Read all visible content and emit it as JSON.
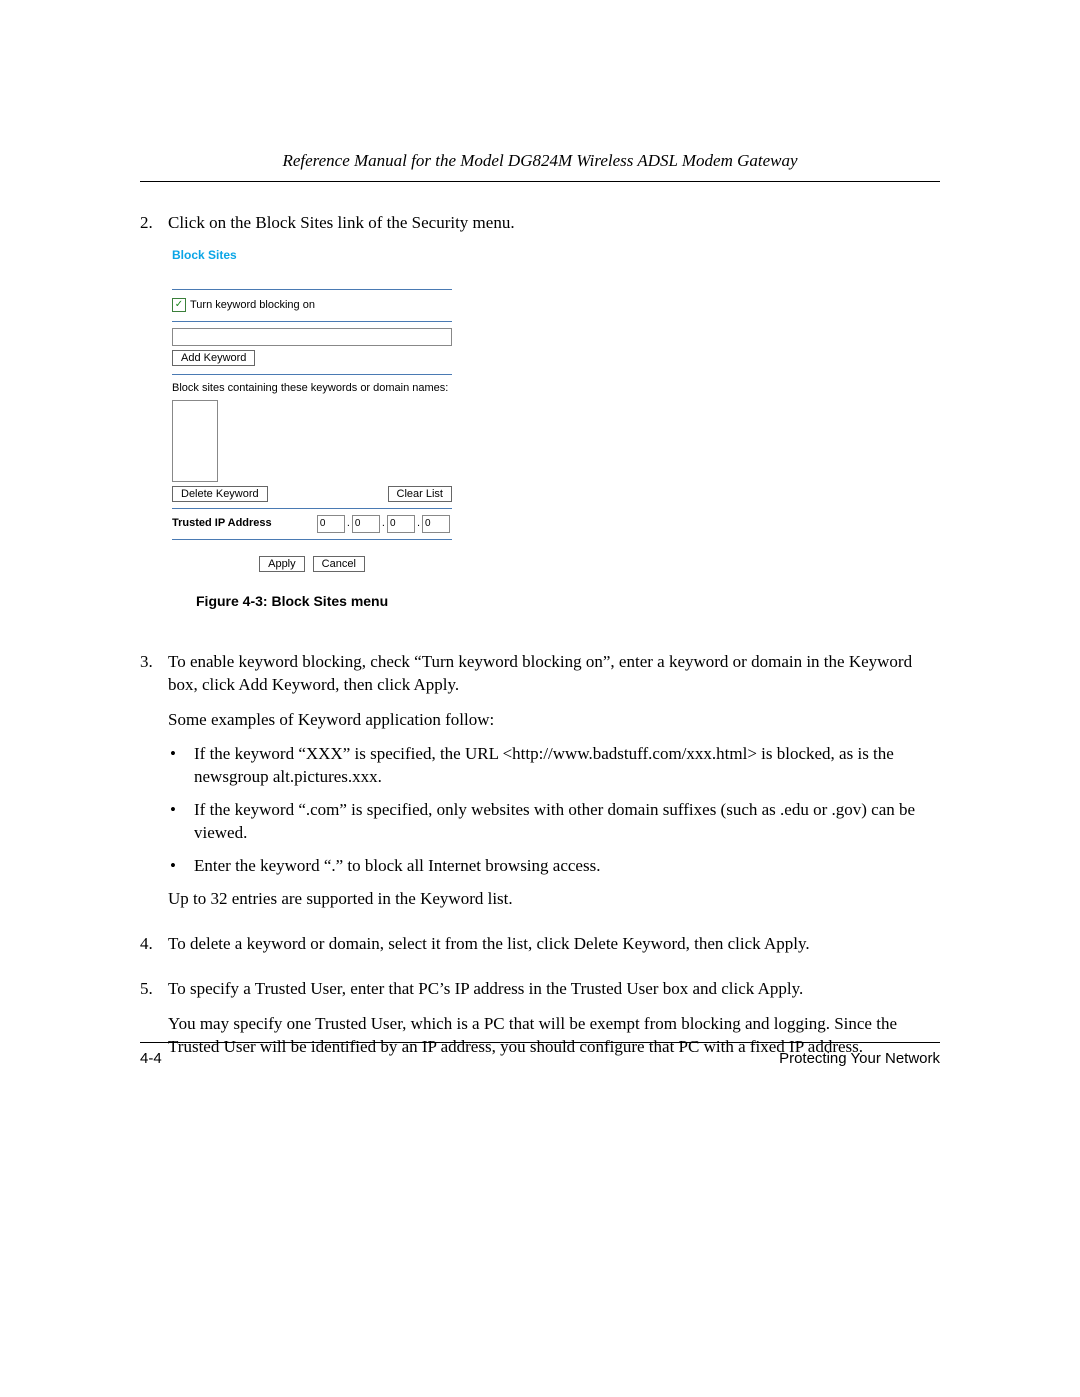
{
  "header": "Reference Manual for the Model DG824M Wireless ADSL Modem Gateway",
  "steps": {
    "s2": {
      "num": "2.",
      "text": "Click on the Block Sites link of the Security menu."
    },
    "s3": {
      "num": "3.",
      "p1": "To enable keyword blocking, check “Turn keyword blocking on”, enter a keyword or domain in the Keyword box, click Add Keyword, then click Apply.",
      "p2": "Some examples of Keyword application follow:",
      "b1": "If the keyword “XXX” is specified, the URL <http://www.badstuff.com/xxx.html> is blocked, as is the newsgroup alt.pictures.xxx.",
      "b2": "If the keyword “.com” is specified, only websites with other domain suffixes (such as .edu or .gov) can be viewed.",
      "b3": "Enter the keyword “.” to block all Internet browsing access.",
      "p3": "Up to 32 entries are supported in the Keyword list."
    },
    "s4": {
      "num": "4.",
      "text": "To delete a keyword or domain, select it from the list, click Delete Keyword, then click Apply."
    },
    "s5": {
      "num": "5.",
      "p1": "To specify a Trusted User, enter that PC’s IP address in the Trusted User box and click Apply.",
      "p2": "You may specify one Trusted User, which is a PC that will be exempt from blocking and logging. Since the Trusted User will be identified by an IP address, you should configure that PC with a fixed IP address."
    }
  },
  "figure_caption": "Figure 4-3: Block Sites menu",
  "router": {
    "title": "Block Sites",
    "checkbox_label": "Turn keyword blocking on",
    "add_button": "Add Keyword",
    "list_label": "Block sites containing these keywords or domain names:",
    "delete_button": "Delete Keyword",
    "clear_button": "Clear List",
    "trusted_label": "Trusted IP Address",
    "ip": {
      "a": "0",
      "b": "0",
      "c": "0",
      "d": "0"
    },
    "apply": "Apply",
    "cancel": "Cancel"
  },
  "footer": {
    "left": "4-4",
    "right": "Protecting Your Network"
  }
}
